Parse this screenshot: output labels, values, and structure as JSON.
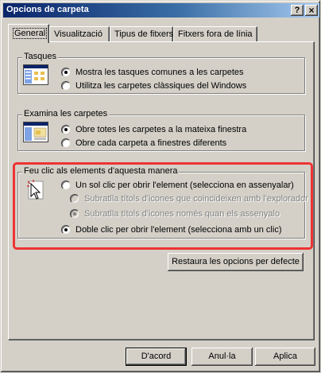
{
  "window": {
    "title": "Opcions de carpeta",
    "help_label": "?",
    "close_label": "×"
  },
  "tabs": [
    {
      "label": "General",
      "active": true
    },
    {
      "label": "Visualització",
      "active": false
    },
    {
      "label": "Tipus de fitxers",
      "active": false
    },
    {
      "label": "Fitxers fora de línia",
      "active": false
    }
  ],
  "tasks": {
    "title": "Tasques",
    "icon": "tasks-folder-icon",
    "options": [
      {
        "label": "Mostra les tasques comunes a les carpetes",
        "checked": true
      },
      {
        "label": "Utilitza les carpetes clàssiques del Windows",
        "checked": false
      }
    ]
  },
  "browse": {
    "title": "Examina les carpetes",
    "icon": "browse-folders-icon",
    "options": [
      {
        "label": "Obre totes les carpetes a la mateixa finestra",
        "checked": true
      },
      {
        "label": "Obre cada carpeta a finestres diferents",
        "checked": false
      }
    ]
  },
  "click": {
    "title": "Feu clic als elements d'aquesta manera",
    "icon": "cursor-click-icon",
    "single_click": {
      "label": "Un sol clic per obrir l'element (selecciona en assenyalar)",
      "checked": false
    },
    "underline_always": {
      "label": "Subratlla títols d'icones que coincideixen amb l'explorador",
      "checked": false,
      "disabled": true
    },
    "underline_point": {
      "label": "Subratlla títols d'icones només quan els assenyalo",
      "checked": true,
      "disabled": true
    },
    "double_click": {
      "label": "Doble clic per obrir l'element (selecciona amb un clic)",
      "checked": true
    }
  },
  "restore_defaults_label": "Restaura les opcions per defecte",
  "footer": {
    "ok_label": "D'acord",
    "cancel_label": "Anul·la",
    "apply_label": "Aplica"
  },
  "colors": {
    "highlight": "#ee3333",
    "titlebar": "#0a246a",
    "face": "#d4d0c8"
  }
}
